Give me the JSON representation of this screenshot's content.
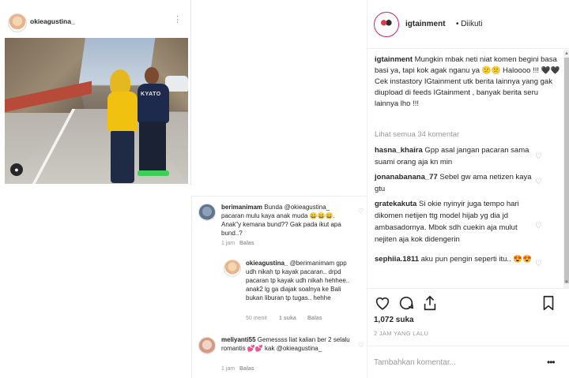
{
  "left_post": {
    "username": "okieagustina_",
    "more_icon": "more-vertical-icon",
    "photo_shirt_text": "KYATO",
    "user_tag_icon": "person-icon"
  },
  "mid_comments": [
    {
      "username": "berimanimam",
      "text": " Bunda @okieagustina_ pacaran mulu kaya anak muda 😀😀😀. Anak\"y kemana bund?? Gak pada ikut apa bund..?",
      "time": "1 jam",
      "reply": "Balas"
    },
    {
      "username": "okieagustina_",
      "text": " @berimanimam gpp udh nikah tp kayak pacaran.. drpd pacaran tp kayak udh nikah hehhee.. anak2 lg ga diajak soalnya ke Bali bukan liburan tp tugas.. hehhe",
      "time": "50 menit",
      "likes": "1 suka",
      "reply": "Balas"
    },
    {
      "username": "meliyanti55",
      "text": " Gemessss liat kalian ber 2 selalu romantis 💕💕 kak @okieagustina_",
      "time": "1 jam",
      "reply": "Balas"
    }
  ],
  "post": {
    "username": "igtainment",
    "follow_status": "• Diikuti",
    "caption_user": "igtainment",
    "caption": " Mungkin mbak neti niat komen begini basa basi ya, tapi kok agak nganu ya 😕😕 Haloooo !!! 🖤🖤 Cek instastory IGtainment utk berita lainnya yang gak diupload di feeds IGtainment , banyak berita seru lainnya lho !!!",
    "view_all": "Lihat semua 34 komentar",
    "comments": [
      {
        "username": "hasna_khaira",
        "text": " Gpp asal jangan pacaran sama suami orang aja kn min"
      },
      {
        "username": "jonanabanana_77",
        "text": " Sebel gw ama netizen kaya gtu"
      },
      {
        "username": "gratekakuta",
        "text": " Si okie nyinyir juga tempo hari dikomen netijen ttg model hijab yg dia jd ambasadornya. Mbok sdh cuekin aja mulut nejiten aja kok didengerin"
      },
      {
        "username": "sephiia.1811",
        "text": " aku pun pengin seperti itu.. 😍😍"
      }
    ],
    "likes": "1,072 suka",
    "time": "2 JAM YANG LALU",
    "add_comment_placeholder": "Tambahkan komentar...",
    "more_label": "•••"
  }
}
